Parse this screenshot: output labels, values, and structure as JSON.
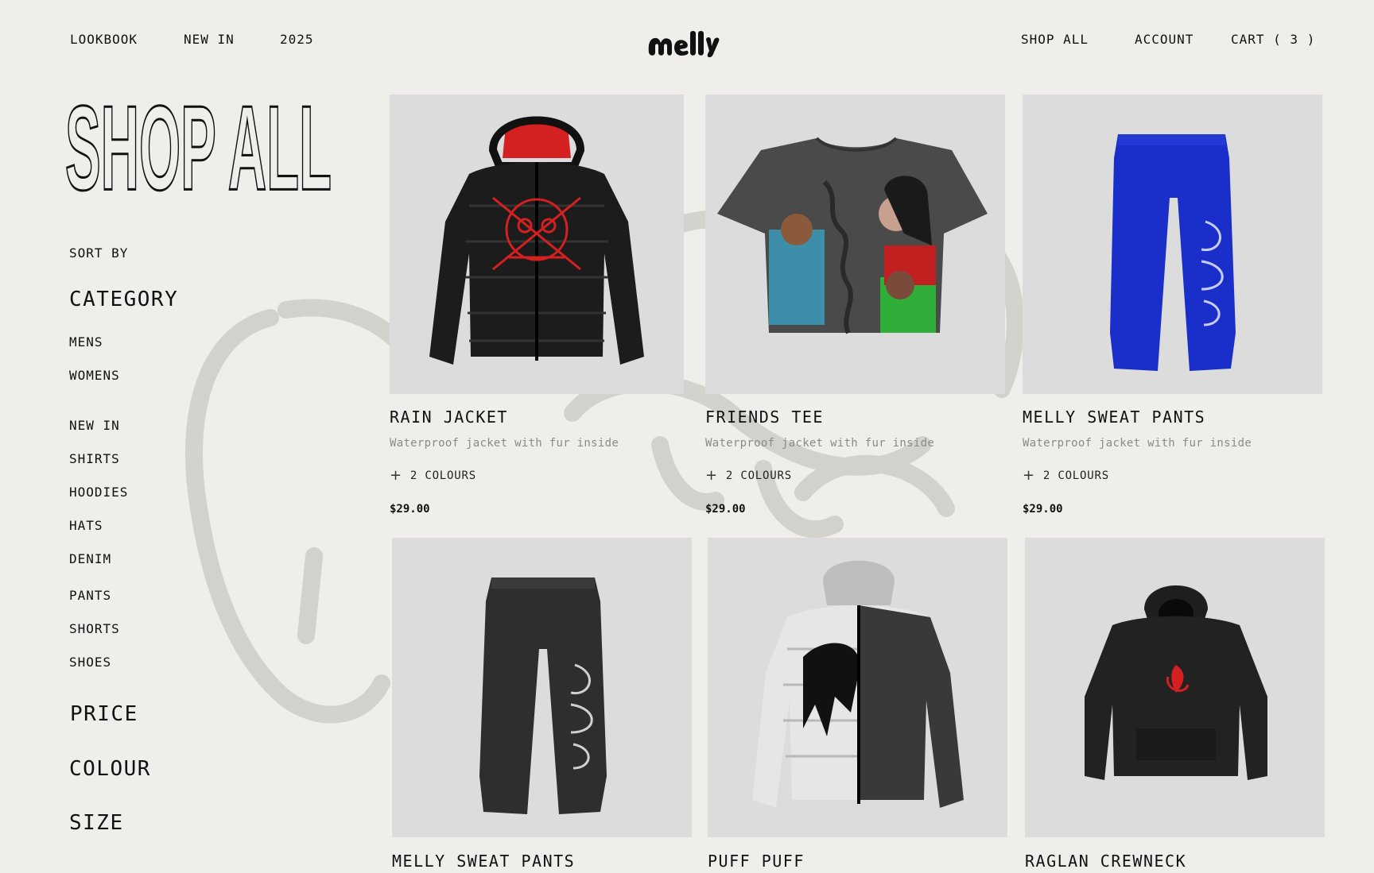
{
  "header": {
    "left_links": [
      "LOOKBOOK",
      "NEW IN",
      "2025"
    ],
    "logo_text": "Melly",
    "shop_all": "SHOP ALL",
    "account": "ACCOUNT",
    "cart": "CART ( 3 )"
  },
  "sidebar": {
    "title": "SHOP ALL",
    "sort_by": "SORT BY",
    "category_heading": "CATEGORY",
    "gender": [
      "MENS",
      "WOMENS"
    ],
    "categories": [
      "NEW IN",
      "SHIRTS",
      "HOODIES",
      "HATS",
      "DENIM",
      "PANTS",
      "SHORTS",
      "SHOES"
    ],
    "price_heading": "PRICE",
    "colour_heading": "COLOUR",
    "size_heading": "SIZE"
  },
  "products": [
    {
      "name": "RAIN JACKET",
      "desc": "Waterproof jacket with fur inside",
      "colours": "2 COLOURS",
      "price": "$29.00",
      "icon": "puffer-jacket-icon"
    },
    {
      "name": "FRIENDS TEE",
      "desc": "Waterproof jacket with fur inside",
      "colours": "2 COLOURS",
      "price": "$29.00",
      "icon": "graphic-tee-icon"
    },
    {
      "name": "MELLY SWEAT PANTS",
      "desc": "Waterproof jacket with fur inside",
      "colours": "2 COLOURS",
      "price": "$29.00",
      "icon": "sweat-pants-icon"
    },
    {
      "name": "MELLY SWEAT PANTS",
      "icon": "sweat-pants-icon"
    },
    {
      "name": "PUFF PUFF",
      "icon": "puffer-jacket-icon"
    },
    {
      "name": "RAGLAN CREWNECK",
      "icon": "hoodie-icon"
    }
  ],
  "colors": {
    "background": "#efeeea",
    "image_bg": "#dcdcdc",
    "accent_red": "#d42020",
    "pants_blue": "#1a2fc9"
  }
}
